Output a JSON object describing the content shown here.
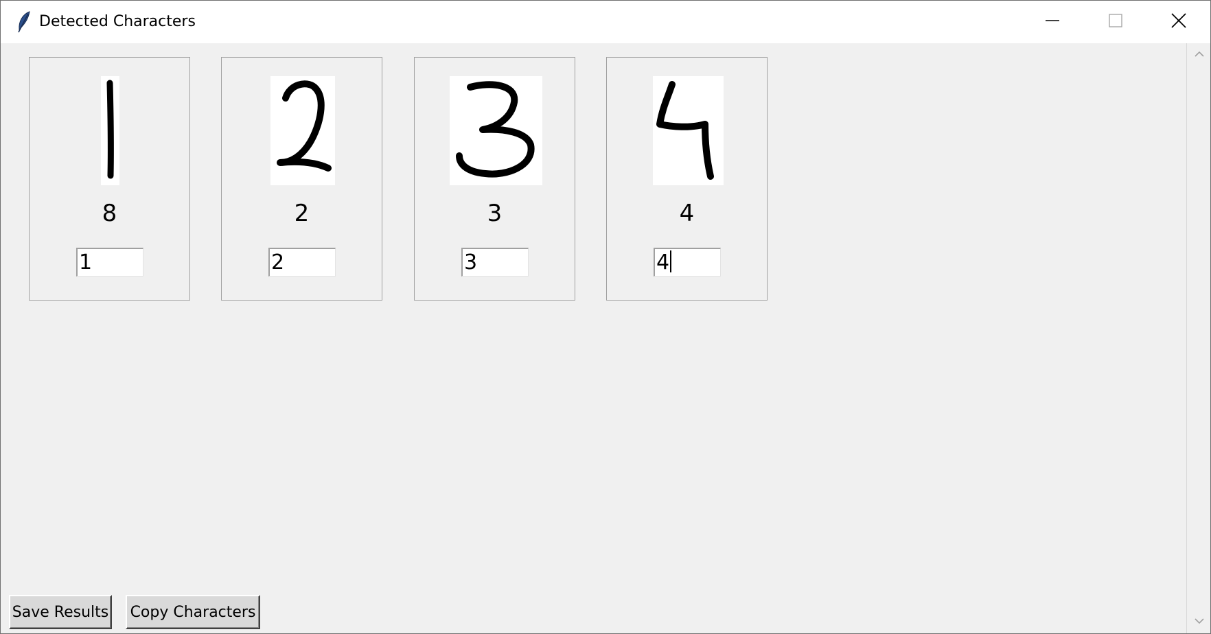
{
  "window": {
    "title": "Detected Characters",
    "controls": [
      "minimize",
      "maximize",
      "close"
    ]
  },
  "characters": [
    {
      "image_digit": "1",
      "predicted": "8",
      "entry_value": "1"
    },
    {
      "image_digit": "2",
      "predicted": "2",
      "entry_value": "2"
    },
    {
      "image_digit": "3",
      "predicted": "3",
      "entry_value": "3"
    },
    {
      "image_digit": "4",
      "predicted": "4",
      "entry_value": "4",
      "focused": true
    }
  ],
  "buttons": {
    "save_label": "Save Results",
    "copy_label": "Copy Characters"
  },
  "icons": {
    "app": "feather-icon",
    "minimize": "minimize-icon",
    "maximize": "maximize-icon",
    "close": "close-icon",
    "scroll_up": "chevron-up-icon",
    "scroll_down": "chevron-down-icon"
  }
}
